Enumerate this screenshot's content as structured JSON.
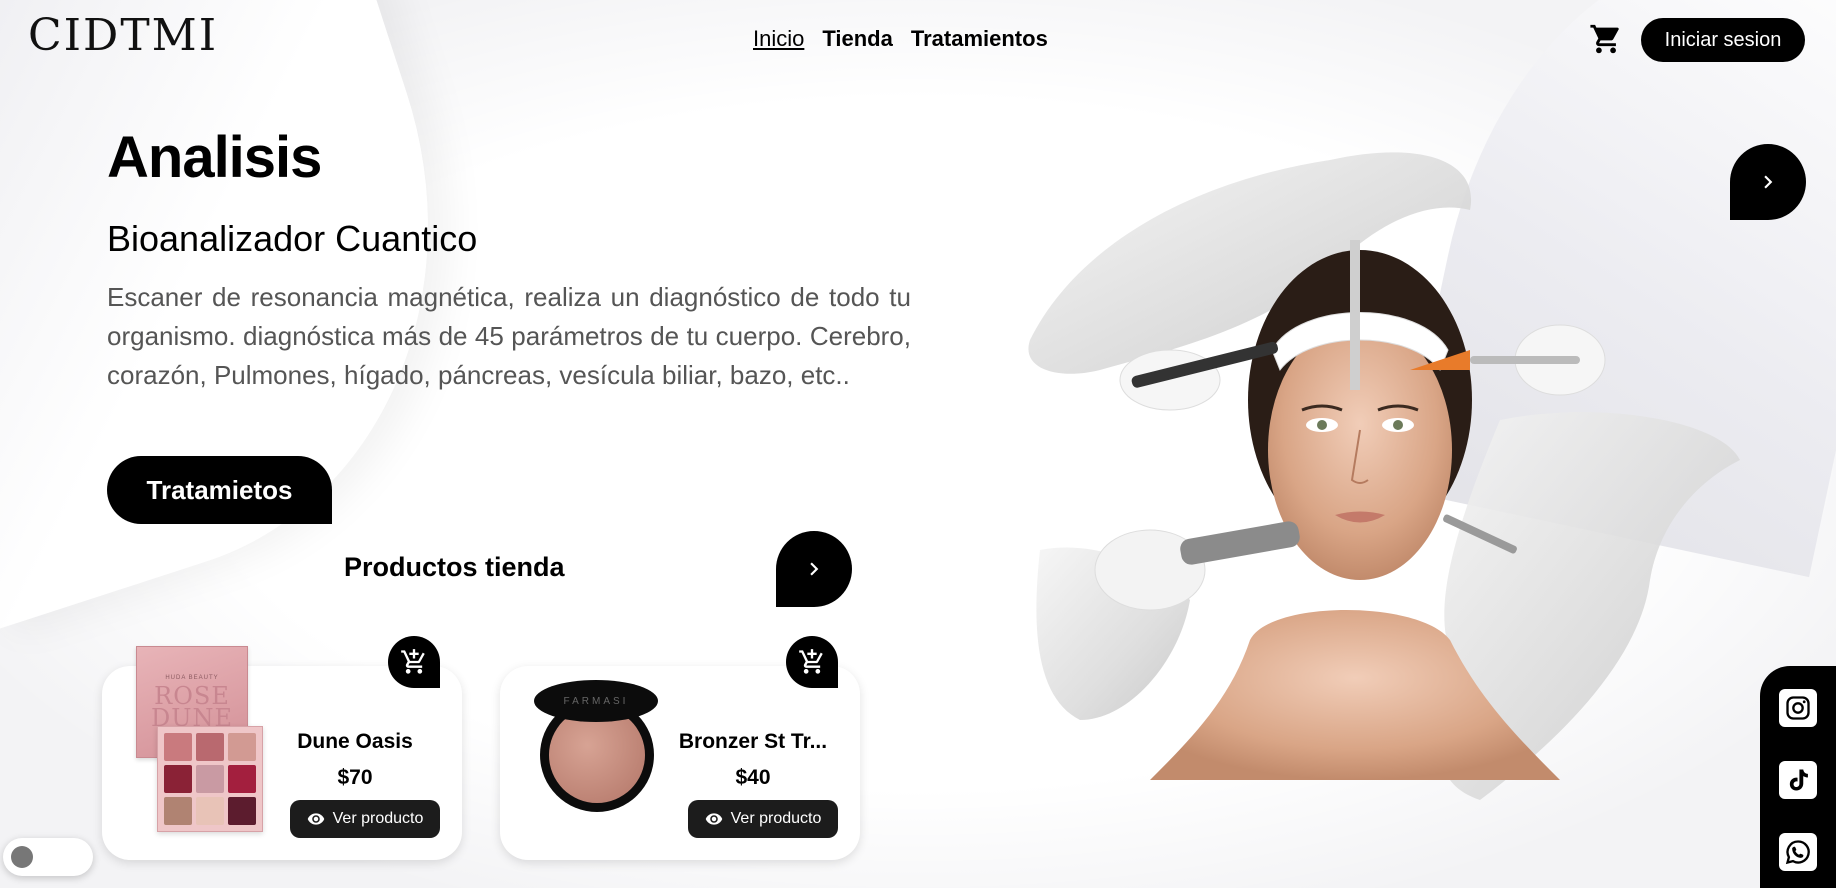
{
  "header": {
    "logo": "CIDTMI",
    "nav": [
      {
        "label": "Inicio",
        "active": true
      },
      {
        "label": "Tienda",
        "active": false
      },
      {
        "label": "Tratamientos",
        "active": false
      }
    ],
    "cart_icon": "cart-icon",
    "login_label": "Iniciar sesion"
  },
  "hero": {
    "title": "Analisis",
    "subtitle": "Bioanalizador Cuantico",
    "description": "Escaner de resonancia magnética, realiza un diagnóstico de todo tu organismo. diagnóstica más de 45 parámetros de tu cuerpo. Cerebro, corazón, Pulmones, hígado, páncreas, vesícula biliar, bazo, etc..",
    "button_label": "Tratamietos",
    "next_icon": "chevron-right-icon"
  },
  "products": {
    "title": "Productos tienda",
    "items": [
      {
        "name": "Dune Oasis",
        "price": "$70",
        "button_label": "Ver producto",
        "image_brand": "HUDA BEAUTY",
        "image_name": "ROSE DUNE"
      },
      {
        "name": "Bronzer St Tr...",
        "price": "$40",
        "button_label": "Ver producto",
        "image_brand": "FARMASI"
      }
    ]
  },
  "social": [
    "instagram-icon",
    "tiktok-icon",
    "whatsapp-icon"
  ],
  "colors": {
    "primary": "#000000",
    "background": "#f3f3f5",
    "text_muted": "#555555"
  }
}
